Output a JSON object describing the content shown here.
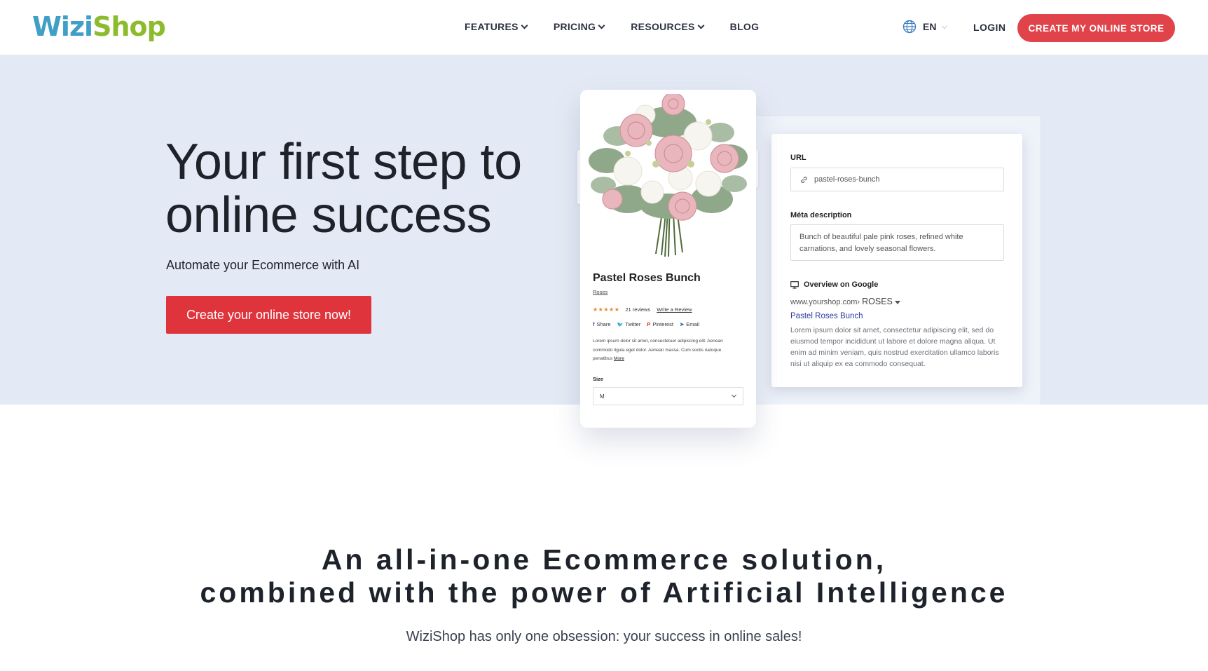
{
  "header": {
    "logo": {
      "part1": "Wizi",
      "part2": "Shop"
    },
    "nav": [
      {
        "label": "FEATURES",
        "dropdown": true
      },
      {
        "label": "PRICING",
        "dropdown": true
      },
      {
        "label": "RESOURCES",
        "dropdown": true
      },
      {
        "label": "BLOG",
        "dropdown": false
      }
    ],
    "language": "EN",
    "language_icon": "globe-icon",
    "login_label": "LOGIN",
    "cta_label": "CREATE MY ONLINE STORE"
  },
  "hero": {
    "title_line1": "Your first step to",
    "title_line2": "online success",
    "subtitle": "Automate your Ecommerce with AI",
    "cta_label": "Create your online store now!"
  },
  "product_card": {
    "title": "Pastel Roses Bunch",
    "category": "Roses",
    "stars": "★★★★★",
    "reviews": "21 reviews",
    "write_review": "Write a Review",
    "share": [
      {
        "icon": "facebook-icon",
        "glyph": "f",
        "label": "Share"
      },
      {
        "icon": "twitter-icon",
        "glyph": "🐦",
        "label": "Twitter"
      },
      {
        "icon": "pinterest-icon",
        "glyph": "P",
        "label": "Pinterest"
      },
      {
        "icon": "email-icon",
        "glyph": "➤",
        "label": "Email"
      }
    ],
    "description": "Lorem ipsum dolor sit amet, consectetuer adipiscing elit. Aenean commodo ligula eget dolor. Aenean massa. Cum sociis natoque penatibus",
    "more_label": "More",
    "size_label": "Size",
    "size_value": "M"
  },
  "seo_card": {
    "url_label": "URL",
    "url_value": "pastel-roses-bunch",
    "meta_label": "Méta description",
    "meta_value": "Bunch of beautiful pale pink roses, refined white carnations, and lovely seasonal flowers.",
    "google_label": "Overview on Google",
    "crumb_site": "www.yourshop.com›",
    "crumb_section": "ROSES",
    "google_title": "Pastel Roses Bunch",
    "google_desc": "Lorem ipsum dolor sit amet, consectetur adipiscing elit, sed do eiusmod tempor incididunt ut labore et dolore magna aliqua. Ut enim ad minim veniam, quis nostrud exercitation ullamco laboris nisi ut aliquip ex ea commodo consequat."
  },
  "section": {
    "title_line1": "An all-in-one Ecommerce solution,",
    "title_line2": "combined with the power of Artificial Intelligence",
    "subtitle": "WiziShop has only one obsession: your success in online sales!"
  },
  "colors": {
    "accent": "#e0434a",
    "hero_bg": "#e4eaf5",
    "logo_blue": "#3f9fc7",
    "logo_green": "#8cbc2e",
    "star": "#e08a2c",
    "link": "#2b3a9b"
  }
}
